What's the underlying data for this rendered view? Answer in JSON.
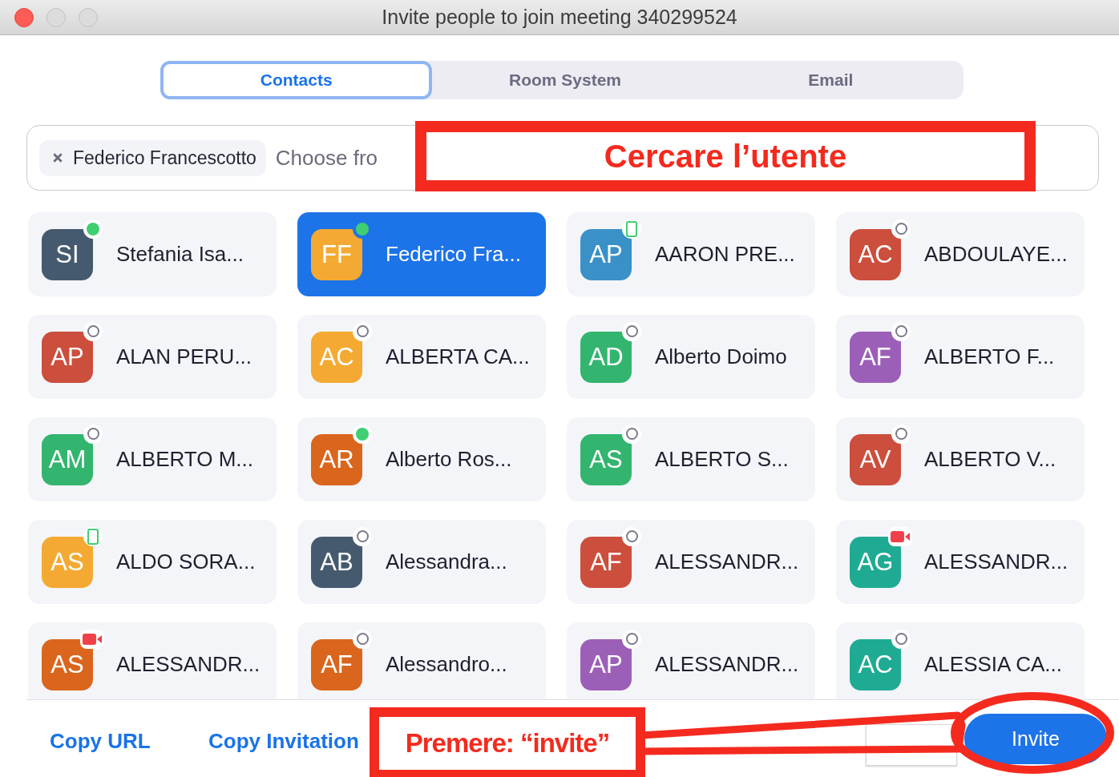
{
  "window": {
    "title": "Invite people to join meeting 340299524"
  },
  "tabs": [
    {
      "label": "Contacts",
      "selected": true
    },
    {
      "label": "Room System",
      "selected": false
    },
    {
      "label": "Email",
      "selected": false
    }
  ],
  "search": {
    "chips": [
      "Federico Francescotto"
    ],
    "placeholder": "Choose fro"
  },
  "contacts": [
    {
      "initials": "SI",
      "name": "Stefania Isa...",
      "color": "#455a6e",
      "kind": "online",
      "selected": false
    },
    {
      "initials": "FF",
      "name": "Federico Fra...",
      "color": "#f4aa32",
      "kind": "online",
      "selected": true
    },
    {
      "initials": "AP",
      "name": "AARON PRE...",
      "color": "#3991c8",
      "kind": "mobile",
      "selected": false
    },
    {
      "initials": "AC",
      "name": "ABDOULAYE...",
      "color": "#cc4e3c",
      "kind": "offline",
      "selected": false
    },
    {
      "initials": "AP",
      "name": "ALAN PERU...",
      "color": "#cc4e3c",
      "kind": "offline",
      "selected": false
    },
    {
      "initials": "AC",
      "name": "ALBERTA CA...",
      "color": "#f4aa32",
      "kind": "offline",
      "selected": false
    },
    {
      "initials": "AD",
      "name": "Alberto Doimo",
      "color": "#33b56f",
      "kind": "offline",
      "selected": false
    },
    {
      "initials": "AF",
      "name": "ALBERTO F...",
      "color": "#9c5fb8",
      "kind": "offline",
      "selected": false
    },
    {
      "initials": "AM",
      "name": "ALBERTO M...",
      "color": "#33b56f",
      "kind": "offline",
      "selected": false
    },
    {
      "initials": "AR",
      "name": "Alberto Ros...",
      "color": "#da661d",
      "kind": "online",
      "selected": false
    },
    {
      "initials": "AS",
      "name": "ALBERTO S...",
      "color": "#33b56f",
      "kind": "offline",
      "selected": false
    },
    {
      "initials": "AV",
      "name": "ALBERTO V...",
      "color": "#cc4e3c",
      "kind": "offline",
      "selected": false
    },
    {
      "initials": "AS",
      "name": "ALDO SORA...",
      "color": "#f4aa32",
      "kind": "mobile",
      "selected": false
    },
    {
      "initials": "AB",
      "name": "Alessandra...",
      "color": "#455a6e",
      "kind": "offline",
      "selected": false
    },
    {
      "initials": "AF",
      "name": "ALESSANDR...",
      "color": "#cc4e3c",
      "kind": "offline",
      "selected": false
    },
    {
      "initials": "AG",
      "name": "ALESSANDR...",
      "color": "#1fab93",
      "kind": "video",
      "selected": false
    },
    {
      "initials": "AS",
      "name": "ALESSANDR...",
      "color": "#da661d",
      "kind": "video",
      "selected": false
    },
    {
      "initials": "AF",
      "name": "Alessandro...",
      "color": "#da661d",
      "kind": "offline",
      "selected": false
    },
    {
      "initials": "AP",
      "name": "ALESSANDR...",
      "color": "#9c5fb8",
      "kind": "offline",
      "selected": false
    },
    {
      "initials": "AC",
      "name": "ALESSIA CA...",
      "color": "#1fab93",
      "kind": "offline",
      "selected": false
    }
  ],
  "footer": {
    "links": [
      "Copy URL",
      "Copy Invitation"
    ],
    "invite_button": "Invite"
  },
  "annotations": [
    {
      "kind": "box",
      "text": "Cercare l’utente"
    },
    {
      "kind": "pointer",
      "text": "Premere: “invite”"
    }
  ]
}
